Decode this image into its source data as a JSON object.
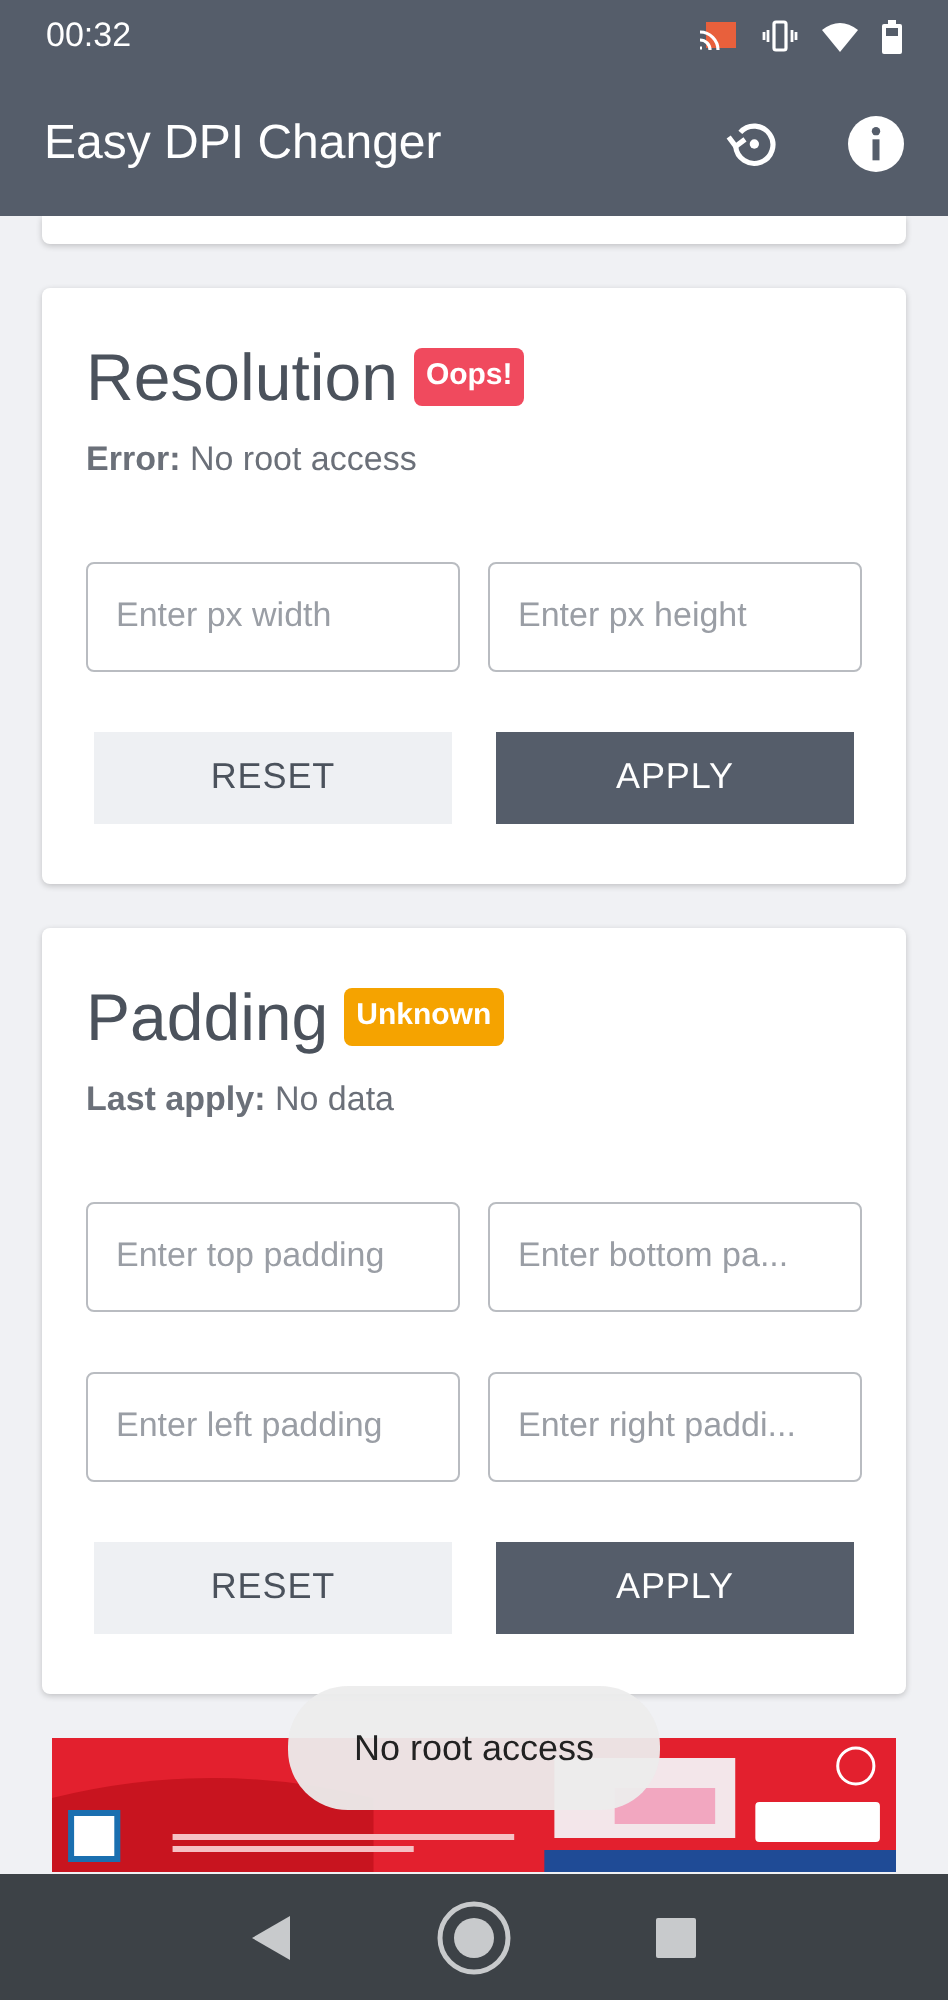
{
  "status_bar": {
    "time": "00:32"
  },
  "app_bar": {
    "title": "Easy DPI Changer"
  },
  "cards": [
    {
      "title": "Resolution",
      "badge": {
        "label": "Oops!",
        "color": "#f04a5e"
      },
      "status": "**Error:** No root access",
      "fields": [
        {
          "placeholder": "Enter px width"
        },
        {
          "placeholder": "Enter px height"
        }
      ],
      "buttons": [
        {
          "label": "RESET",
          "kind": "secondary"
        },
        {
          "label": "APPLY",
          "kind": "primary"
        }
      ]
    },
    {
      "title": "Padding",
      "badge": {
        "label": "Unknown",
        "color": "#f5a300"
      },
      "status": "**Last apply:** No data",
      "fields": [
        {
          "placeholder": "Enter top padding"
        },
        {
          "placeholder": "Enter bottom pa..."
        },
        {
          "placeholder": "Enter left padding"
        },
        {
          "placeholder": "Enter right paddi..."
        }
      ],
      "buttons": [
        {
          "label": "RESET",
          "kind": "secondary"
        },
        {
          "label": "APPLY",
          "kind": "primary"
        }
      ]
    }
  ],
  "toast": {
    "text": "No root access"
  }
}
